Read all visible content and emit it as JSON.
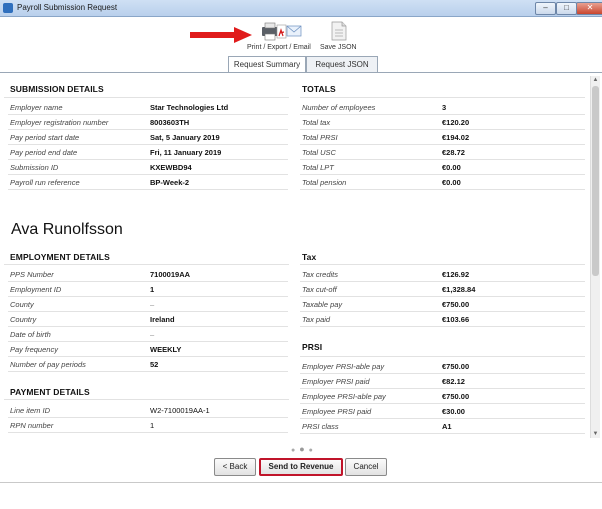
{
  "window": {
    "title": "Payroll Submission Request"
  },
  "toolbar": {
    "print_label": "Print / Export / Email",
    "save_json_label": "Save JSON"
  },
  "tabs": [
    {
      "label": "Request Summary"
    },
    {
      "label": "Request JSON"
    }
  ],
  "submission_details": {
    "heading": "SUBMISSION DETAILS",
    "rows": [
      {
        "label": "Employer name",
        "value": "Star Technologies Ltd"
      },
      {
        "label": "Employer registration number",
        "value": "8003603TH"
      },
      {
        "label": "Pay period start date",
        "value": "Sat, 5 January 2019"
      },
      {
        "label": "Pay period end date",
        "value": "Fri, 11 January 2019"
      },
      {
        "label": "Submission ID",
        "value": "KXEWBD94"
      },
      {
        "label": "Payroll run reference",
        "value": "BP-Week-2"
      }
    ]
  },
  "totals": {
    "heading": "TOTALS",
    "rows": [
      {
        "label": "Number of employees",
        "value": "3"
      },
      {
        "label": "Total tax",
        "value": "€120.20"
      },
      {
        "label": "Total PRSI",
        "value": "€194.02"
      },
      {
        "label": "Total USC",
        "value": "€28.72"
      },
      {
        "label": "Total LPT",
        "value": "€0.00"
      },
      {
        "label": "Total pension",
        "value": "€0.00"
      }
    ]
  },
  "employee": {
    "name": "Ava Runolfsson"
  },
  "employment_details": {
    "heading": "EMPLOYMENT DETAILS",
    "rows": [
      {
        "label": "PPS Number",
        "value": "7100019AA"
      },
      {
        "label": "Employment ID",
        "value": "1"
      },
      {
        "label": "County",
        "value": "–"
      },
      {
        "label": "Country",
        "value": "Ireland"
      },
      {
        "label": "Date of birth",
        "value": "–"
      },
      {
        "label": "Pay frequency",
        "value": "WEEKLY"
      },
      {
        "label": "Number of pay periods",
        "value": "52"
      }
    ]
  },
  "tax": {
    "heading": "Tax",
    "rows": [
      {
        "label": "Tax credits",
        "value": "€126.92"
      },
      {
        "label": "Tax cut-off",
        "value": "€1,328.84"
      },
      {
        "label": "Taxable pay",
        "value": "€750.00"
      },
      {
        "label": "Tax paid",
        "value": "€103.66"
      }
    ]
  },
  "prsi": {
    "heading": "PRSI",
    "rows": [
      {
        "label": "Employer PRSI-able pay",
        "value": "€750.00"
      },
      {
        "label": "Employer PRSI paid",
        "value": "€82.12"
      },
      {
        "label": "Employee PRSI-able pay",
        "value": "€750.00"
      },
      {
        "label": "Employee PRSI paid",
        "value": "€30.00"
      },
      {
        "label": "PRSI class",
        "value": "A1"
      }
    ]
  },
  "payment_details": {
    "heading": "PAYMENT DETAILS",
    "rows": [
      {
        "label": "Line item ID",
        "value": "W2-7100019AA-1"
      },
      {
        "label": "RPN number",
        "value": "1"
      }
    ]
  },
  "buttons": {
    "back": "< Back",
    "send": "Send to Revenue",
    "cancel": "Cancel"
  },
  "colors": {
    "accent_red": "#c0142a",
    "titlebar": "#c4d8f0"
  }
}
